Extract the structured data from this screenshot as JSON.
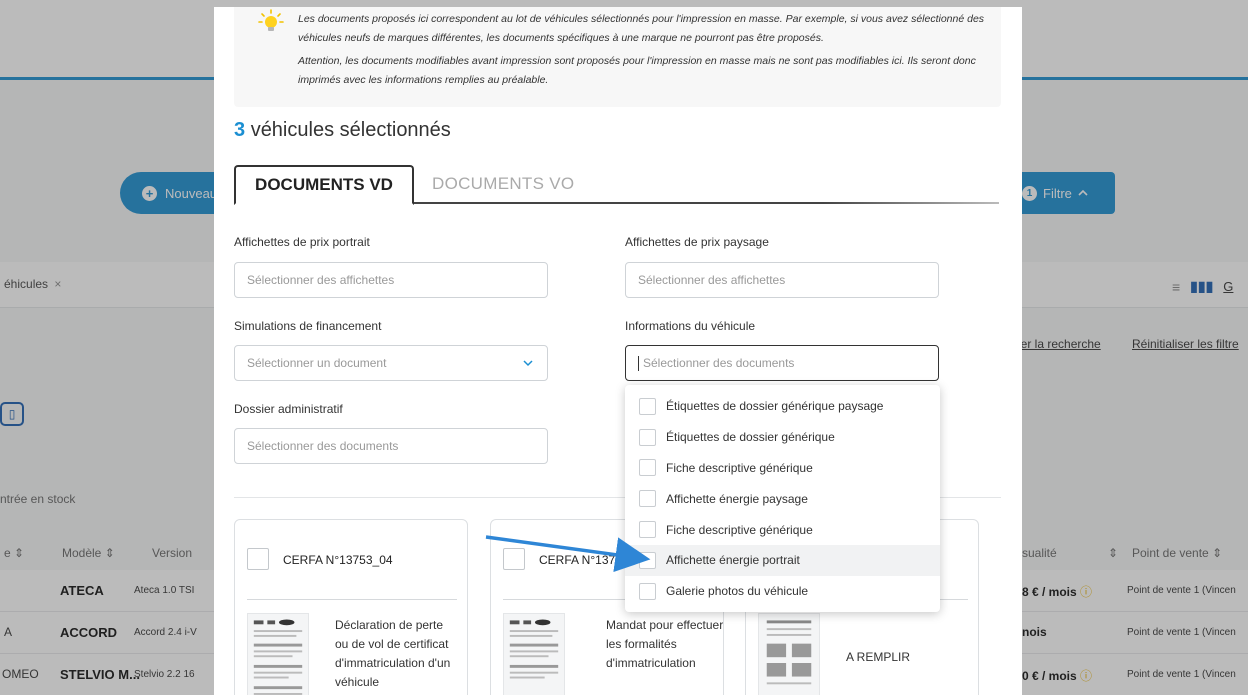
{
  "background": {
    "new_button_label": "Nouveau",
    "filter_count": "1",
    "filter_label": "Filtre",
    "chip_label": "éhicules",
    "chip_close": "×",
    "view_letter": "G",
    "save_search_link": "rder la recherche",
    "reset_filters_link": "Réinitialiser les filtre",
    "entree_stock_label": "ntrée en stock",
    "table_headers": {
      "col_e": "e",
      "col_modele": "Modèle",
      "col_version": "Version",
      "col_mensualite": "sualité",
      "col_point_vente": "Point de vente"
    },
    "rows": [
      {
        "marque": "",
        "modele": "ATECA",
        "version": "Ateca 1.0 TSI",
        "prix": "8 € / mois",
        "coin": "ⓘ",
        "point_vente": "Point de vente 1 (Vincen"
      },
      {
        "marque": "A",
        "modele": "ACCORD",
        "version": "Accord 2.4 i-V",
        "prix": "nois",
        "coin": "",
        "point_vente": "Point de vente 1 (Vincen"
      },
      {
        "marque": "OMEO",
        "modele": "STELVIO M...",
        "version": "Stelvio 2.2 16",
        "prix": "0 € / mois",
        "coin": "ⓘ",
        "point_vente": "Point de vente 1 (Vincen"
      }
    ]
  },
  "modal": {
    "info_p1": "Les documents proposés ici correspondent au lot de véhicules sélectionnés pour l'impression en masse. Par exemple, si vous avez sélectionné des véhicules neufs de marques différentes, les documents spécifiques à une marque ne pourront pas être proposés.",
    "info_p2": "Attention, les documents modifiables avant impression sont proposés pour l'impression en masse mais ne sont pas modifiables ici. Ils seront donc imprimés avec les informations remplies au préalable.",
    "selected_count": "3",
    "selected_suffix": "véhicules sélectionnés",
    "tabs": {
      "vd": "DOCUMENTS VD",
      "vo": "DOCUMENTS VO"
    },
    "fields": {
      "prix_portrait": {
        "label": "Affichettes de prix portrait",
        "placeholder": "Sélectionner des affichettes"
      },
      "prix_paysage": {
        "label": "Affichettes de prix paysage",
        "placeholder": "Sélectionner des affichettes"
      },
      "simulations": {
        "label": "Simulations de financement",
        "placeholder": "Sélectionner un document"
      },
      "infos_vehicule": {
        "label": "Informations du véhicule",
        "placeholder": "Sélectionner des documents"
      },
      "dossier": {
        "label": "Dossier administratif",
        "placeholder": "Sélectionner des documents"
      }
    },
    "dropdown_items": [
      "Étiquettes de dossier générique paysage",
      "Étiquettes de dossier générique",
      "Fiche descriptive générique",
      "Affichette énergie paysage",
      "Fiche descriptive générique",
      "Affichette énergie portrait",
      "Galerie photos du véhicule"
    ],
    "cards": [
      {
        "title": "CERFA N°13753_04",
        "description": "Déclaration de perte ou de vol de certificat d'immatriculation d'un véhicule"
      },
      {
        "title": "CERFA N°1375",
        "description": "Mandat pour effectuer les formalités d'immatriculation"
      },
      {
        "title": "",
        "description": "A REMPLIR"
      }
    ]
  },
  "colors": {
    "accent": "#1b8fd2",
    "arrow": "#2e86d6"
  }
}
